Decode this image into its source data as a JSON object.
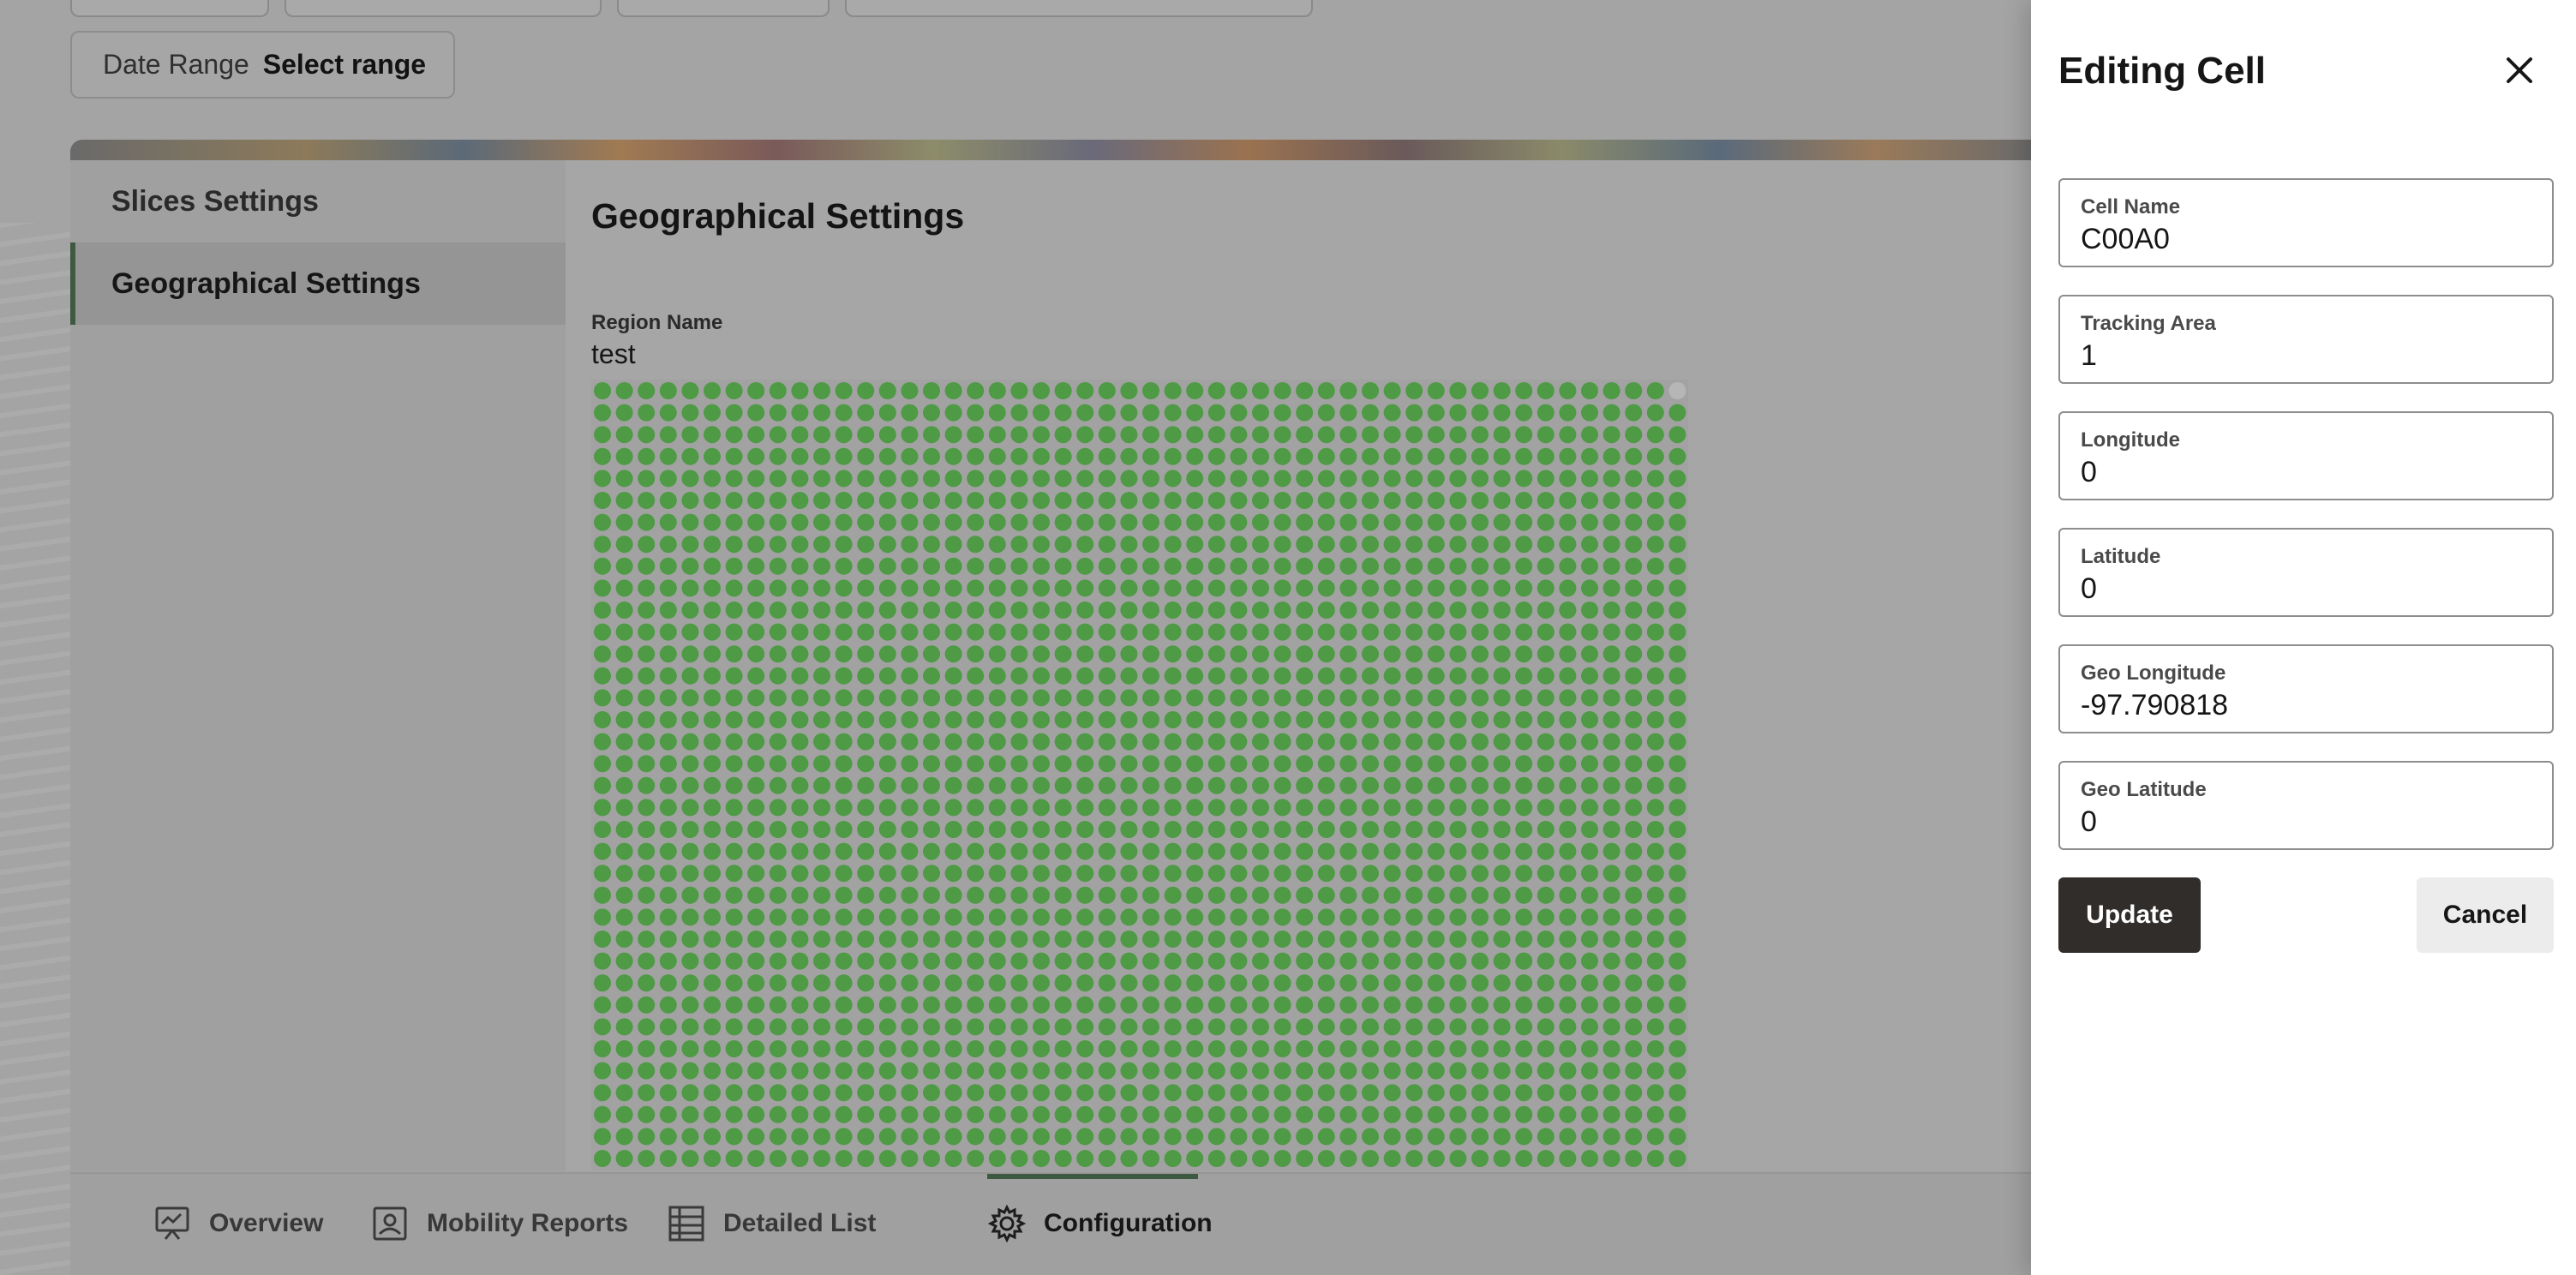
{
  "filters": {
    "date_range_label": "Date Range",
    "date_range_value": "Select range"
  },
  "sidenav": {
    "items": [
      {
        "label": "Slices Settings",
        "active": false
      },
      {
        "label": "Geographical Settings",
        "active": true
      }
    ]
  },
  "content": {
    "title": "Geographical Settings",
    "region_name_label": "Region Name",
    "region_name_value": "test",
    "cell_grid": {
      "columns": 50,
      "rows": 36,
      "cell_color": "#4e9a45",
      "inactive_color": "#b6b6b6"
    }
  },
  "bottom_tabs": [
    {
      "label": "Overview",
      "icon": "presentation-icon",
      "active": false
    },
    {
      "label": "Mobility Reports",
      "icon": "report-icon",
      "active": false
    },
    {
      "label": "Detailed List",
      "icon": "list-icon",
      "active": false
    },
    {
      "label": "Configuration",
      "icon": "gear-icon",
      "active": true
    }
  ],
  "drawer": {
    "title": "Editing Cell",
    "close_icon": "close-icon",
    "fields": [
      {
        "label": "Cell Name",
        "value": "C00A0"
      },
      {
        "label": "Tracking Area",
        "value": "1"
      },
      {
        "label": "Longitude",
        "value": "0"
      },
      {
        "label": "Latitude",
        "value": "0"
      },
      {
        "label": "Geo Longitude",
        "value": "-97.790818"
      },
      {
        "label": "Geo Latitude",
        "value": "0"
      }
    ],
    "update_label": "Update",
    "cancel_label": "Cancel"
  },
  "colors": {
    "accent": "#3d5a40",
    "primary_button": "#302d2b",
    "cell_active": "#4e9a45"
  }
}
